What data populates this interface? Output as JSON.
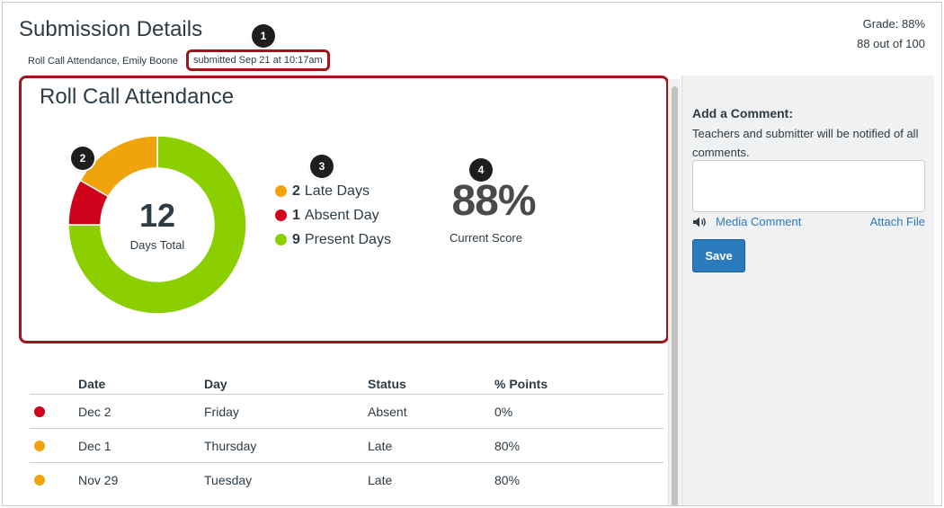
{
  "header": {
    "title": "Submission Details",
    "assignment_user": "Roll Call Attendance, Emily Boone",
    "submitted": "submitted Sep 21 at 10:17am",
    "grade_line": "Grade: 88%",
    "score_line": "88 out of 100"
  },
  "callouts": [
    "1",
    "2",
    "3",
    "4"
  ],
  "summary": {
    "title": "Roll Call Attendance",
    "total_number": "12",
    "total_caption": "Days Total",
    "legend": [
      {
        "count": "2",
        "label": "Late Days",
        "color": "#f0a30a"
      },
      {
        "count": "1",
        "label": "Absent Day",
        "color": "#d0021b"
      },
      {
        "count": "9",
        "label": "Present Days",
        "color": "#8ccf00"
      }
    ],
    "score_value": "88%",
    "score_caption": "Current Score"
  },
  "donut": {
    "segments": [
      {
        "name": "present",
        "value": 9,
        "color": "#8ccf00"
      },
      {
        "name": "absent",
        "value": 1,
        "color": "#d0021b"
      },
      {
        "name": "late",
        "value": 2,
        "color": "#f0a30a"
      }
    ]
  },
  "table": {
    "columns": [
      "Date",
      "Day",
      "Status",
      "% Points"
    ],
    "rows": [
      {
        "color": "#d0021b",
        "date": "Dec 2",
        "day": "Friday",
        "status": "Absent",
        "points": "0%"
      },
      {
        "color": "#f0a30a",
        "date": "Dec 1",
        "day": "Thursday",
        "status": "Late",
        "points": "80%"
      },
      {
        "color": "#f0a30a",
        "date": "Nov 29",
        "day": "Tuesday",
        "status": "Late",
        "points": "80%"
      }
    ]
  },
  "sidebar": {
    "comment_label": "Add a Comment:",
    "comment_help": "Teachers and submitter will be notified of all comments.",
    "comment_value": "",
    "media_comment": "Media Comment",
    "attach_file": "Attach File",
    "save_label": "Save"
  },
  "icons": {
    "speaker": "speaker-icon"
  }
}
